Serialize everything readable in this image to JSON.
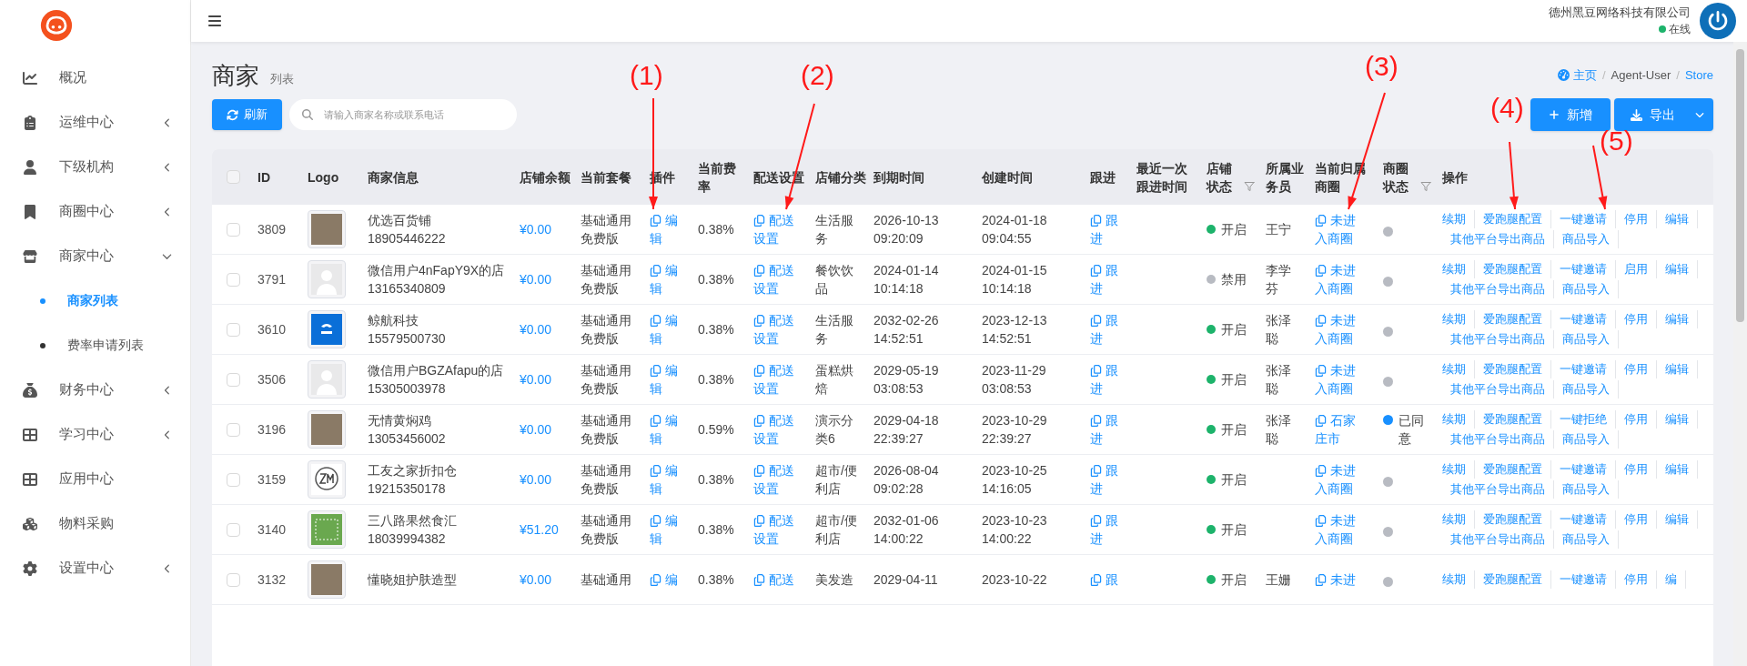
{
  "logo": {
    "kind": "dog"
  },
  "sidebar": {
    "items": [
      {
        "label": "概况"
      },
      {
        "label": "运维中心",
        "expanded": false
      },
      {
        "label": "下级机构",
        "expanded": false
      },
      {
        "label": "商圈中心",
        "expanded": false
      },
      {
        "label": "商家中心",
        "expanded": true,
        "children": [
          {
            "label": "商家列表",
            "selected": true
          },
          {
            "label": "费率申请列表",
            "selected": false
          }
        ]
      },
      {
        "label": "财务中心",
        "expanded": false
      },
      {
        "label": "学习中心",
        "expanded": false
      },
      {
        "label": "应用中心"
      },
      {
        "label": "物料采购"
      },
      {
        "label": "设置中心",
        "expanded": false
      }
    ]
  },
  "header": {
    "company": "德州黑豆网络科技有限公司",
    "status": {
      "label": "在线",
      "color": "#1db36b"
    }
  },
  "page": {
    "title": "商家",
    "subtitle": "列表"
  },
  "breadcrumb": [
    {
      "label": "主页",
      "link": true
    },
    {
      "separator": "/",
      "label": "Agent-User",
      "link": false
    },
    {
      "separator": "/",
      "label": "Store",
      "link": true
    }
  ],
  "toolbar": {
    "refresh": "刷新",
    "search": {
      "placeholder": "请输入商家名称或联系电话"
    },
    "add": "新增",
    "export": "导出"
  },
  "table": {
    "header_checked": false,
    "columns": [
      {
        "label": "ID",
        "filter": false
      },
      {
        "label": "Logo",
        "filter": false
      },
      {
        "label": "商家信息",
        "filter": false
      },
      {
        "label": "店铺余额",
        "filter": false
      },
      {
        "label": "当前套餐",
        "filter": false
      },
      {
        "label": "插件",
        "filter": false
      },
      {
        "label": "当前费率",
        "filter": false
      },
      {
        "label": "配送设置",
        "filter": false
      },
      {
        "label": "店铺分类",
        "filter": false
      },
      {
        "label": "到期时间",
        "filter": false
      },
      {
        "label": "创建时间",
        "filter": false
      },
      {
        "label": "跟进",
        "filter": false
      },
      {
        "label": "最近一次跟进时间",
        "filter": false
      },
      {
        "label": "店铺状态",
        "filter": true
      },
      {
        "label": "所属业务员",
        "filter": false
      },
      {
        "label": "当前归属商圈",
        "filter": false
      },
      {
        "label": "商圈状态",
        "filter": true
      },
      {
        "label": "操作",
        "filter": false
      }
    ],
    "rows": [
      {
        "checked": false,
        "id": "3809",
        "logo": {
          "kind": "photo"
        },
        "name": "优选百货铺",
        "phone": "18905446222",
        "balance": "¥0.00",
        "plan": "基础通用免费版",
        "plugin": "编辑",
        "rate": "0.38%",
        "delivery": "配送设置",
        "category": "生活服务",
        "expiry": "2026-10-13 09:20:09",
        "created": "2024-01-18 09:04:55",
        "follow": "跟进",
        "store_status": {
          "label": "开启",
          "color": "#1db36b"
        },
        "salesperson": "王宁",
        "circle": "未进入商圈",
        "circle_status": {
          "color": "#b8bbc2"
        },
        "actions": [
          {
            "label": "续期"
          },
          {
            "label": "爱跑腿配置"
          },
          {
            "label": "一键邀请"
          },
          {
            "label": "停用"
          },
          {
            "label": "编辑"
          },
          {
            "label": "其他平台导出商品"
          },
          {
            "label": "商品导入"
          }
        ]
      },
      {
        "checked": false,
        "id": "3791",
        "logo": {
          "kind": "avatar"
        },
        "name": "微信用户4nFapY9X的店",
        "phone": "13165340809",
        "balance": "¥0.00",
        "plan": "基础通用免费版",
        "plugin": "编辑",
        "rate": "0.38%",
        "delivery": "配送设置",
        "category": "餐饮饮品",
        "expiry": "2024-01-14 10:14:18",
        "created": "2024-01-15 10:14:18",
        "follow": "跟进",
        "store_status": {
          "label": "禁用",
          "color": "#b8bbc2"
        },
        "salesperson": "李学芬",
        "circle": "未进入商圈",
        "circle_status": {
          "color": "#b8bbc2"
        },
        "actions": [
          {
            "label": "续期"
          },
          {
            "label": "爱跑腿配置"
          },
          {
            "label": "一键邀请"
          },
          {
            "label": "启用"
          },
          {
            "label": "编辑"
          },
          {
            "label": "其他平台导出商品"
          },
          {
            "label": "商品导入"
          }
        ]
      },
      {
        "checked": false,
        "id": "3610",
        "logo": {
          "kind": "blue"
        },
        "name": "鲸航科技",
        "phone": "15579500730",
        "balance": "¥0.00",
        "plan": "基础通用免费版",
        "plugin": "编辑",
        "rate": "0.38%",
        "delivery": "配送设置",
        "category": "生活服务",
        "expiry": "2032-02-26 14:52:51",
        "created": "2023-12-13 14:52:51",
        "follow": "跟进",
        "store_status": {
          "label": "开启",
          "color": "#1db36b"
        },
        "salesperson": "张泽聪",
        "circle": "未进入商圈",
        "circle_status": {
          "color": "#b8bbc2"
        },
        "actions": [
          {
            "label": "续期"
          },
          {
            "label": "爱跑腿配置"
          },
          {
            "label": "一键邀请"
          },
          {
            "label": "停用"
          },
          {
            "label": "编辑"
          },
          {
            "label": "其他平台导出商品"
          },
          {
            "label": "商品导入"
          }
        ]
      },
      {
        "checked": false,
        "id": "3506",
        "logo": {
          "kind": "avatar"
        },
        "name": "微信用户BGZAfapu的店",
        "phone": "15305003978",
        "balance": "¥0.00",
        "plan": "基础通用免费版",
        "plugin": "编辑",
        "rate": "0.38%",
        "delivery": "配送设置",
        "category": "蛋糕烘焙",
        "expiry": "2029-05-19 03:08:53",
        "created": "2023-11-29 03:08:53",
        "follow": "跟进",
        "store_status": {
          "label": "开启",
          "color": "#1db36b"
        },
        "salesperson": "张泽聪",
        "circle": "未进入商圈",
        "circle_status": {
          "color": "#b8bbc2"
        },
        "actions": [
          {
            "label": "续期"
          },
          {
            "label": "爱跑腿配置"
          },
          {
            "label": "一键邀请"
          },
          {
            "label": "停用"
          },
          {
            "label": "编辑"
          },
          {
            "label": "其他平台导出商品"
          },
          {
            "label": "商品导入"
          }
        ]
      },
      {
        "checked": false,
        "id": "3196",
        "logo": {
          "kind": "photo"
        },
        "name": "无情黄焖鸡",
        "phone": "13053456002",
        "balance": "¥0.00",
        "plan": "基础通用免费版",
        "plugin": "编辑",
        "rate": "0.59%",
        "delivery": "配送设置",
        "category": "演示分类6",
        "expiry": "2029-04-18 22:39:27",
        "created": "2023-10-29 22:39:27",
        "follow": "跟进",
        "store_status": {
          "label": "开启",
          "color": "#1db36b"
        },
        "salesperson": "张泽聪",
        "circle": "石家庄市",
        "circle_status": {
          "color": "#1890ff",
          "label": "已同意"
        },
        "actions": [
          {
            "label": "续期"
          },
          {
            "label": "爱跑腿配置"
          },
          {
            "label": "一键拒绝"
          },
          {
            "label": "停用"
          },
          {
            "label": "编辑"
          },
          {
            "label": "其他平台导出商品"
          },
          {
            "label": "商品导入"
          }
        ]
      },
      {
        "checked": false,
        "id": "3159",
        "logo": {
          "kind": "monogram"
        },
        "name": "工友之家折扣仓",
        "phone": "19215350178",
        "balance": "¥0.00",
        "plan": "基础通用免费版",
        "plugin": "编辑",
        "rate": "0.38%",
        "delivery": "配送设置",
        "category": "超市/便利店",
        "expiry": "2026-08-04 09:02:28",
        "created": "2023-10-25 14:16:05",
        "follow": "跟进",
        "store_status": {
          "label": "开启",
          "color": "#1db36b"
        },
        "circle": "未进入商圈",
        "circle_status": {
          "color": "#b8bbc2"
        },
        "actions": [
          {
            "label": "续期"
          },
          {
            "label": "爱跑腿配置"
          },
          {
            "label": "一键邀请"
          },
          {
            "label": "停用"
          },
          {
            "label": "编辑"
          },
          {
            "label": "其他平台导出商品"
          },
          {
            "label": "商品导入"
          }
        ]
      },
      {
        "checked": false,
        "id": "3140",
        "logo": {
          "kind": "green"
        },
        "name": "三八路果然食汇",
        "phone": "18039994382",
        "balance": "¥51.20",
        "plan": "基础通用免费版",
        "plugin": "编辑",
        "rate": "0.38%",
        "delivery": "配送设置",
        "category": "超市/便利店",
        "expiry": "2032-01-06 14:00:22",
        "created": "2023-10-23 14:00:22",
        "follow": "跟进",
        "store_status": {
          "label": "开启",
          "color": "#1db36b"
        },
        "circle": "未进入商圈",
        "circle_status": {
          "color": "#b8bbc2"
        },
        "actions": [
          {
            "label": "续期"
          },
          {
            "label": "爱跑腿配置"
          },
          {
            "label": "一键邀请"
          },
          {
            "label": "停用"
          },
          {
            "label": "编辑"
          },
          {
            "label": "其他平台导出商品"
          },
          {
            "label": "商品导入"
          }
        ]
      },
      {
        "checked": false,
        "id": "3132",
        "logo": {
          "kind": "photo"
        },
        "name": "懂晓姐护肤造型",
        "balance": "¥0.00",
        "plan": "基础通用",
        "plugin": "编",
        "rate": "0.38%",
        "delivery": "配送",
        "category": "美发造",
        "expiry": "2029-04-11",
        "created": "2023-10-22",
        "follow": "跟",
        "store_status": {
          "label": "开启",
          "color": "#1db36b"
        },
        "salesperson": "王姗",
        "circle": "未进",
        "circle_status": {
          "color": "#b8bbc2"
        },
        "actions": [
          {
            "label": "续期"
          },
          {
            "label": "爱跑腿配置"
          },
          {
            "label": "一键邀请"
          },
          {
            "label": "停用"
          },
          {
            "label": "编"
          }
        ]
      }
    ]
  },
  "annotations": [
    {
      "label": "(1)"
    },
    {
      "label": "(2)"
    },
    {
      "label": "(3)"
    },
    {
      "label": "(4)"
    },
    {
      "label": "(5)"
    }
  ]
}
